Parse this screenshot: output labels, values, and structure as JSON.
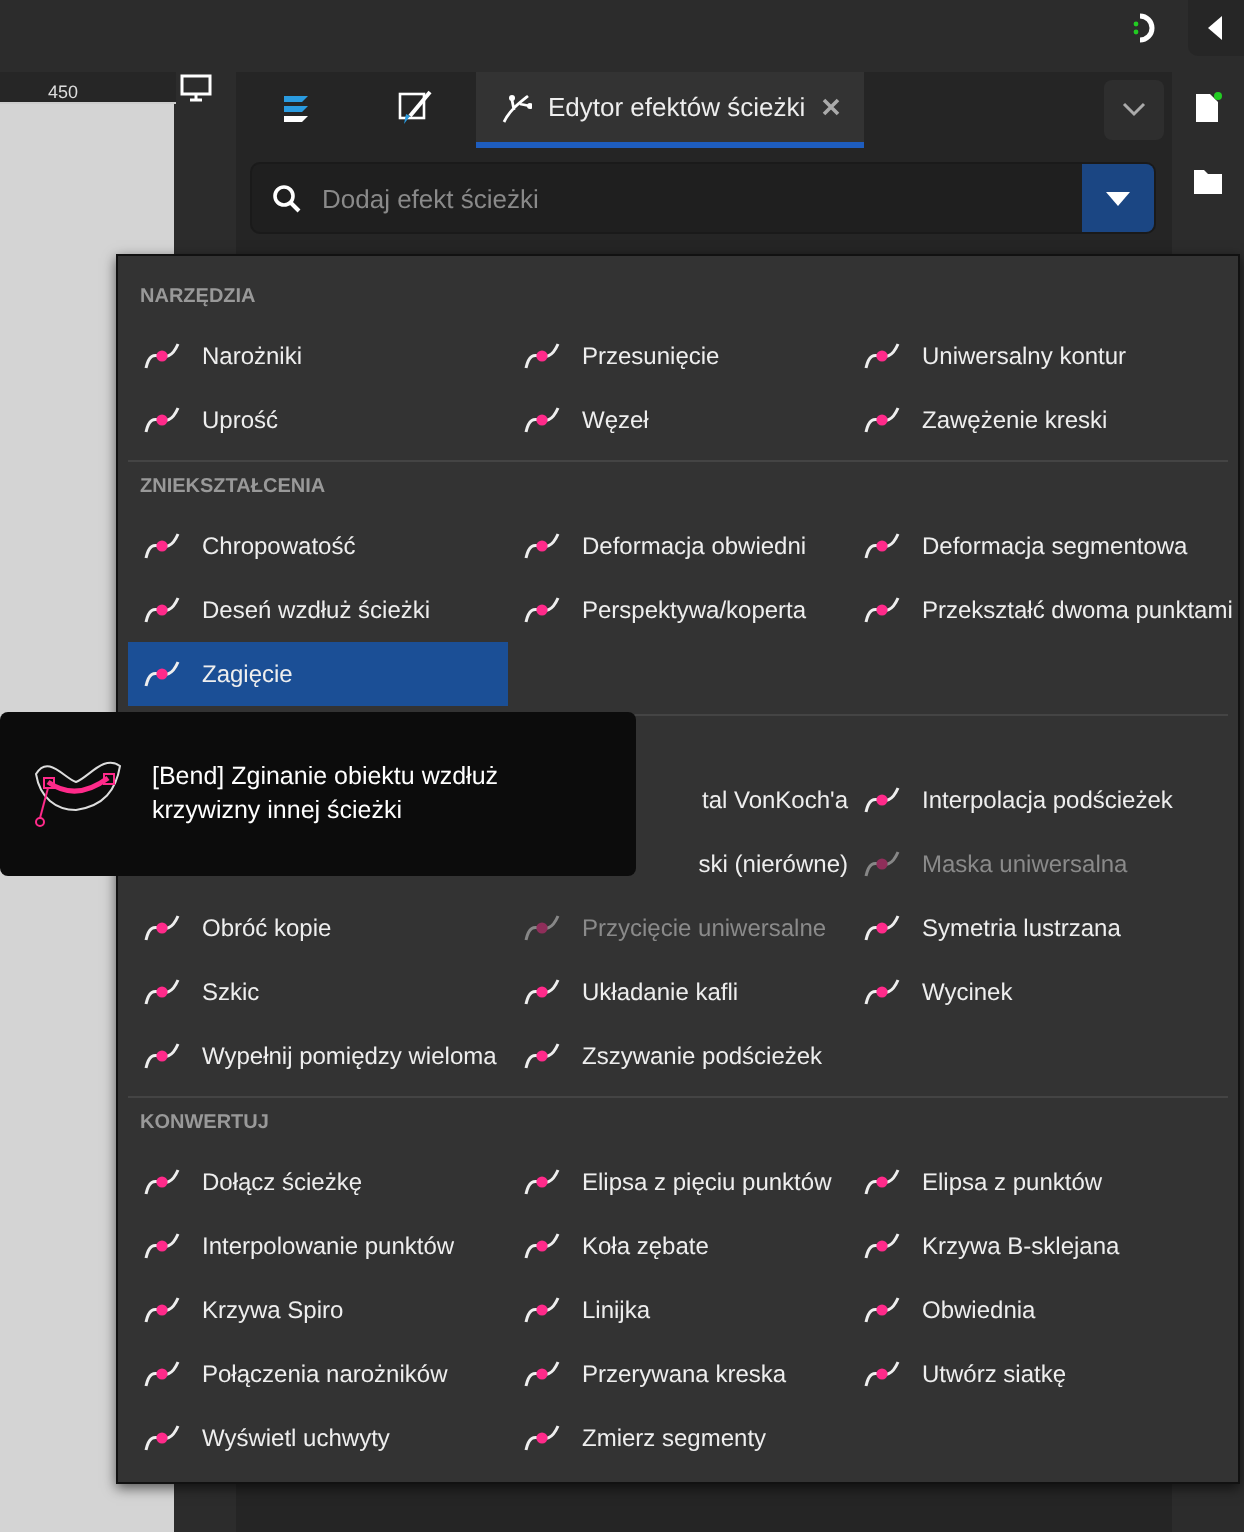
{
  "ruler": {
    "label": "450"
  },
  "tabs": [
    {
      "kind": "layers",
      "selected": false
    },
    {
      "kind": "brush",
      "selected": false
    },
    {
      "kind": "path-effects",
      "label": "Edytor efektów ścieżki",
      "selected": true
    }
  ],
  "search": {
    "placeholder": "Dodaj efekt ścieżki"
  },
  "menu": {
    "sections": [
      {
        "title": "NARZĘDZIA",
        "items": [
          {
            "label": "Narożniki",
            "selected": false,
            "disabled": false
          },
          {
            "label": "Przesunięcie",
            "selected": false,
            "disabled": false
          },
          {
            "label": "Uniwersalny kontur",
            "selected": false,
            "disabled": false
          },
          {
            "label": "Uprość",
            "selected": false,
            "disabled": false
          },
          {
            "label": "Węzeł",
            "selected": false,
            "disabled": false
          },
          {
            "label": "Zawężenie kreski",
            "selected": false,
            "disabled": false
          }
        ]
      },
      {
        "title": "ZNIEKSZTAŁCENIA",
        "items": [
          {
            "label": "Chropowatość",
            "selected": false,
            "disabled": false
          },
          {
            "label": "Deformacja obwiedni",
            "selected": false,
            "disabled": false
          },
          {
            "label": "Deformacja segmentowa",
            "selected": false,
            "disabled": false
          },
          {
            "label": "Deseń wzdłuż ścieżki",
            "selected": false,
            "disabled": false
          },
          {
            "label": "Perspektywa/koperta",
            "selected": false,
            "disabled": false
          },
          {
            "label": "Przekształć dwoma punktami",
            "selected": false,
            "disabled": false
          },
          {
            "label": "Zagięcie",
            "selected": true,
            "disabled": false
          }
        ]
      },
      {
        "items": [
          {
            "kind": "clipped",
            "label": "tal VonKoch'a",
            "selected": false,
            "disabled": false
          },
          {
            "kind": "full",
            "label": "Interpolacja podścieżek",
            "selected": false,
            "disabled": false
          },
          {
            "kind": "clipped",
            "label": "ski (nierówne)",
            "selected": false,
            "disabled": false
          },
          {
            "kind": "full",
            "label": "Maska uniwersalna",
            "selected": false,
            "disabled": true
          },
          {
            "kind": "full",
            "label": "Obróć kopie",
            "selected": false,
            "disabled": false
          },
          {
            "kind": "full",
            "label": "Przycięcie uniwersalne",
            "selected": false,
            "disabled": true
          },
          {
            "kind": "full",
            "label": "Symetria lustrzana",
            "selected": false,
            "disabled": false
          },
          {
            "kind": "full",
            "label": "Szkic",
            "selected": false,
            "disabled": false
          },
          {
            "kind": "full",
            "label": "Układanie kafli",
            "selected": false,
            "disabled": false
          },
          {
            "kind": "full",
            "label": "Wycinek",
            "selected": false,
            "disabled": false
          },
          {
            "kind": "full",
            "label": "Wypełnij pomiędzy wieloma",
            "selected": false,
            "disabled": false
          },
          {
            "kind": "full",
            "label": "Zszywanie podścieżek",
            "selected": false,
            "disabled": false
          }
        ]
      },
      {
        "title": "KONWERTUJ",
        "items": [
          {
            "label": "Dołącz ścieżkę",
            "selected": false,
            "disabled": false
          },
          {
            "label": "Elipsa z pięciu punktów",
            "selected": false,
            "disabled": false
          },
          {
            "label": "Elipsa z punktów",
            "selected": false,
            "disabled": false
          },
          {
            "label": "Interpolowanie punktów",
            "selected": false,
            "disabled": false
          },
          {
            "label": "Koła zębate",
            "selected": false,
            "disabled": false
          },
          {
            "label": "Krzywa B-sklejana",
            "selected": false,
            "disabled": false
          },
          {
            "label": "Krzywa Spiro",
            "selected": false,
            "disabled": false
          },
          {
            "label": "Linijka",
            "selected": false,
            "disabled": false
          },
          {
            "label": "Obwiednia",
            "selected": false,
            "disabled": false
          },
          {
            "label": "Połączenia narożników",
            "selected": false,
            "disabled": false
          },
          {
            "label": "Przerywana kreska",
            "selected": false,
            "disabled": false
          },
          {
            "label": "Utwórz siatkę",
            "selected": false,
            "disabled": false
          },
          {
            "label": "Wyświetl uchwyty",
            "selected": false,
            "disabled": false
          },
          {
            "label": "Zmierz segmenty",
            "selected": false,
            "disabled": false
          }
        ]
      }
    ]
  },
  "tooltip": {
    "text": "[Bend] Zginanie obiektu wzdłuż krzywizny innej ścieżki"
  }
}
